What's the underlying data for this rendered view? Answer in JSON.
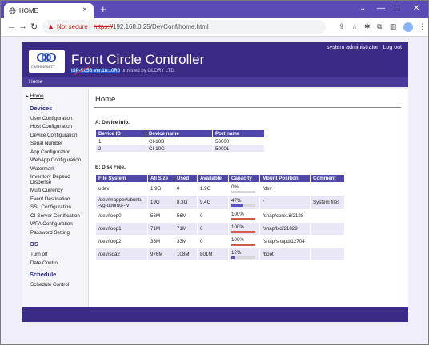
{
  "browser": {
    "tab_title": "HOME",
    "new_tab_glyph": "+",
    "close_glyph": "×",
    "security_label": "Not secure",
    "url_protocol": "https://",
    "url_rest": "192.168.0.25/DevConf/home.html"
  },
  "header": {
    "title": "Front Circle Controller",
    "version_selected": "ISP-K05B Ver.18.10R0",
    "version_rest": " provided by GLORY LTD.",
    "user": "system administrator",
    "logout": "Log out",
    "logo_text": "CASHINFINITY"
  },
  "subnav": {
    "home": "Home"
  },
  "sidebar": {
    "home": "Home",
    "devices_heading": "Devices",
    "devices": [
      "User Configuration",
      "Host Configuration",
      "Device Configuration",
      "Serial Number",
      "App Configuration",
      "WebApp Configuration",
      "Watermark",
      "Inventory Depend",
      "Dispense",
      "Multi Currency",
      "Event Destination",
      "SSL Configuration",
      "CI-Server Certification",
      "WPA Configuration",
      "Password Setting"
    ],
    "os_heading": "OS",
    "os": [
      "Turn off",
      "Date Control"
    ],
    "schedule_heading": "Schedule",
    "schedule": [
      "Schedule Control"
    ]
  },
  "main": {
    "heading": "Home",
    "device_info_title": "A: Device Info.",
    "device_table": {
      "headers": [
        "Device ID",
        "Device name",
        "Port name"
      ],
      "rows": [
        [
          "1",
          "CI-10B",
          "50000"
        ],
        [
          "2",
          "CI-10C",
          "50001"
        ]
      ]
    },
    "disk_title": "B: Disk Free.",
    "disk_table": {
      "headers": [
        "File System",
        "All Size",
        "Used",
        "Available",
        "Capacity",
        "Mount Position",
        "Comment"
      ],
      "rows": [
        {
          "fs": "udev",
          "size": "1.9G",
          "used": "0",
          "avail": "1.9G",
          "cap": "0%",
          "cap_pct": 0,
          "mount": "/dev",
          "comment": ""
        },
        {
          "fs": "/dev/mapper/ubuntu--vg-ubuntu--lv",
          "fs_line1": "/dev/mapper/ubuntu-",
          "fs_line2": "-vg-ubuntu--lv",
          "size": "19G",
          "used": "8.3G",
          "avail": "9.4G",
          "cap": "47%",
          "cap_pct": 47,
          "mount": "/",
          "comment": "System files"
        },
        {
          "fs": "/dev/loop0",
          "size": "56M",
          "used": "56M",
          "avail": "0",
          "cap": "100%",
          "cap_pct": 100,
          "mount": "/snap/core18/2128",
          "comment": ""
        },
        {
          "fs": "/dev/loop1",
          "size": "71M",
          "used": "71M",
          "avail": "0",
          "cap": "100%",
          "cap_pct": 100,
          "mount": "/snap/lxd/21029",
          "comment": ""
        },
        {
          "fs": "/dev/loop2",
          "size": "33M",
          "used": "33M",
          "avail": "0",
          "cap": "100%",
          "cap_pct": 100,
          "mount": "/snap/snapd/12704",
          "comment": ""
        },
        {
          "fs": "/dev/sda2",
          "size": "976M",
          "used": "108M",
          "avail": "801M",
          "cap": "12%",
          "cap_pct": 12,
          "mount": "/boot",
          "comment": ""
        }
      ]
    }
  },
  "colors": {
    "brand": "#3b2a86",
    "table_header": "#4f47a6",
    "row_light": "#ffffff",
    "row_alt": "#e9e7f5",
    "capacity_low": "#5b52c9",
    "capacity_full": "#d35a4a"
  }
}
